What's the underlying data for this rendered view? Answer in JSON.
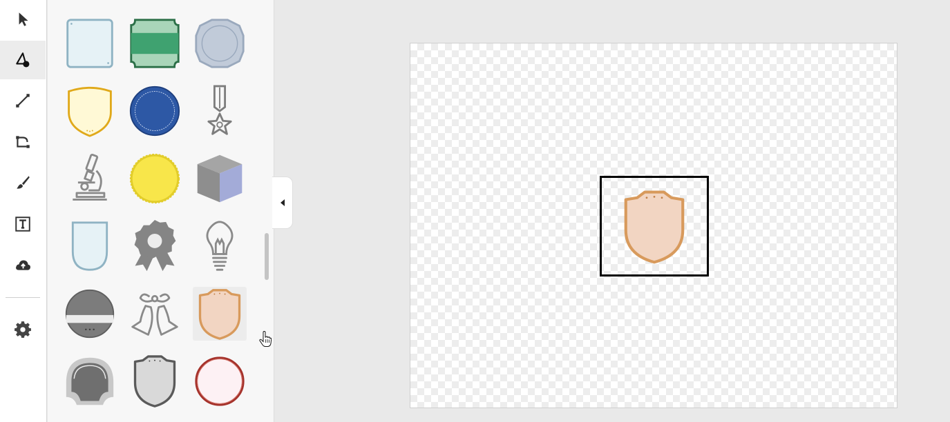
{
  "toolbar": {
    "tools": [
      {
        "id": "select",
        "icon": "pointer-arrow-icon",
        "active": false
      },
      {
        "id": "fill",
        "icon": "paint-fill-icon",
        "active": true
      },
      {
        "id": "line",
        "icon": "line-tool-icon",
        "active": false
      },
      {
        "id": "connector",
        "icon": "connector-tool-icon",
        "active": false
      },
      {
        "id": "brush",
        "icon": "paint-brush-icon",
        "active": false
      },
      {
        "id": "text",
        "icon": "text-box-icon",
        "active": false
      },
      {
        "id": "upload",
        "icon": "cloud-upload-icon",
        "active": false
      },
      {
        "id": "settings",
        "icon": "gear-icon",
        "active": false
      }
    ]
  },
  "shape_library": {
    "items": [
      {
        "id": "square-plaque",
        "icon": "square-plaque-badge-icon",
        "colors": {
          "fill": "#e6f2f6",
          "stroke": "#8fb3c3"
        }
      },
      {
        "id": "green-scroll-badge",
        "icon": "green-scroll-badge-icon",
        "colors": {
          "fill": "#a9d5b9",
          "stroke": "#2b6f47",
          "band": "#3fa270"
        }
      },
      {
        "id": "octagon-seal",
        "icon": "octagon-seal-icon",
        "colors": {
          "fill": "#c1cbd9",
          "stroke": "#9aa9bd"
        }
      },
      {
        "id": "yellow-shield",
        "icon": "yellow-shield-icon",
        "colors": {
          "fill": "#fff9d6",
          "stroke": "#e0a91a"
        }
      },
      {
        "id": "blue-round-seal",
        "icon": "blue-round-seal-icon",
        "colors": {
          "fill": "#2d58a5",
          "stroke": "#1e3f7e"
        }
      },
      {
        "id": "star-medal",
        "icon": "star-medal-icon",
        "colors": {
          "stroke": "#7d7d7d"
        }
      },
      {
        "id": "microscope",
        "icon": "microscope-icon",
        "colors": {
          "stroke": "#8a8a8a"
        }
      },
      {
        "id": "sun-seal",
        "icon": "yellow-sun-seal-icon",
        "colors": {
          "fill": "#f8e64a",
          "stroke": "#e2cd2a"
        }
      },
      {
        "id": "cube",
        "icon": "cube-icon",
        "colors": {
          "top": "#a5a5a5",
          "left": "#8e8e8e",
          "right": "#a3abd8"
        }
      },
      {
        "id": "blue-shield-plain",
        "icon": "light-blue-shield-icon",
        "colors": {
          "fill": "#e6f2f6",
          "stroke": "#8fb3c3"
        }
      },
      {
        "id": "rosette-award",
        "icon": "rosette-award-icon",
        "colors": {
          "fill": "#858585"
        }
      },
      {
        "id": "light-bulb",
        "icon": "light-bulb-icon",
        "colors": {
          "stroke": "#8a8a8a"
        }
      },
      {
        "id": "gray-banner-circle",
        "icon": "gray-banner-circle-icon",
        "colors": {
          "fill": "#7c7c7c",
          "band": "#ececec"
        }
      },
      {
        "id": "bells",
        "icon": "wedding-bells-icon",
        "colors": {
          "stroke": "#8a8a8a"
        }
      },
      {
        "id": "peach-shield",
        "icon": "peach-shield-icon",
        "colors": {
          "fill": "#f2d5c2",
          "stroke": "#d89a5c"
        },
        "hovered": true
      },
      {
        "id": "gray-arch-badge",
        "icon": "gray-arch-badge-icon",
        "colors": {
          "fill": "#6f6f6f",
          "ring": "#c8c8c8"
        }
      },
      {
        "id": "gray-shield",
        "icon": "gray-shield-icon",
        "colors": {
          "fill": "#d9d9d9",
          "stroke": "#5a5a5a"
        }
      },
      {
        "id": "red-ring-circle",
        "icon": "red-ring-circle-icon",
        "colors": {
          "fill": "#fdf1f4",
          "stroke": "#a5322b"
        }
      }
    ]
  },
  "canvas": {
    "selected_shape": "peach-shield",
    "selection_color": "#000000",
    "shape_colors": {
      "fill": "#f2d5c2",
      "stroke": "#d89a5c"
    }
  },
  "panel_toggle": {
    "icon": "collapse-left-icon"
  }
}
